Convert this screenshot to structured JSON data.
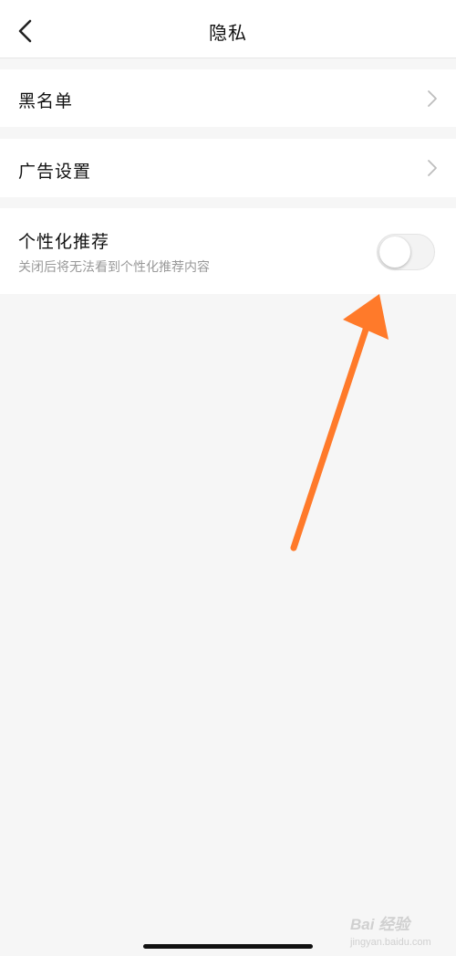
{
  "header": {
    "title": "隐私",
    "back_icon": "chevron-left-icon"
  },
  "settings": {
    "blacklist_label": "黑名单",
    "ad_settings_label": "广告设置",
    "personalization": {
      "label": "个性化推荐",
      "description": "关闭后将无法看到个性化推荐内容",
      "enabled": false
    }
  },
  "annotation": {
    "arrow_color": "#ff7a2a"
  },
  "watermark": {
    "text": "Bai 经验",
    "url": "jingyan.baidu.com"
  },
  "colors": {
    "background": "#f6f6f6",
    "row": "#ffffff",
    "secondary_text": "#999999"
  }
}
